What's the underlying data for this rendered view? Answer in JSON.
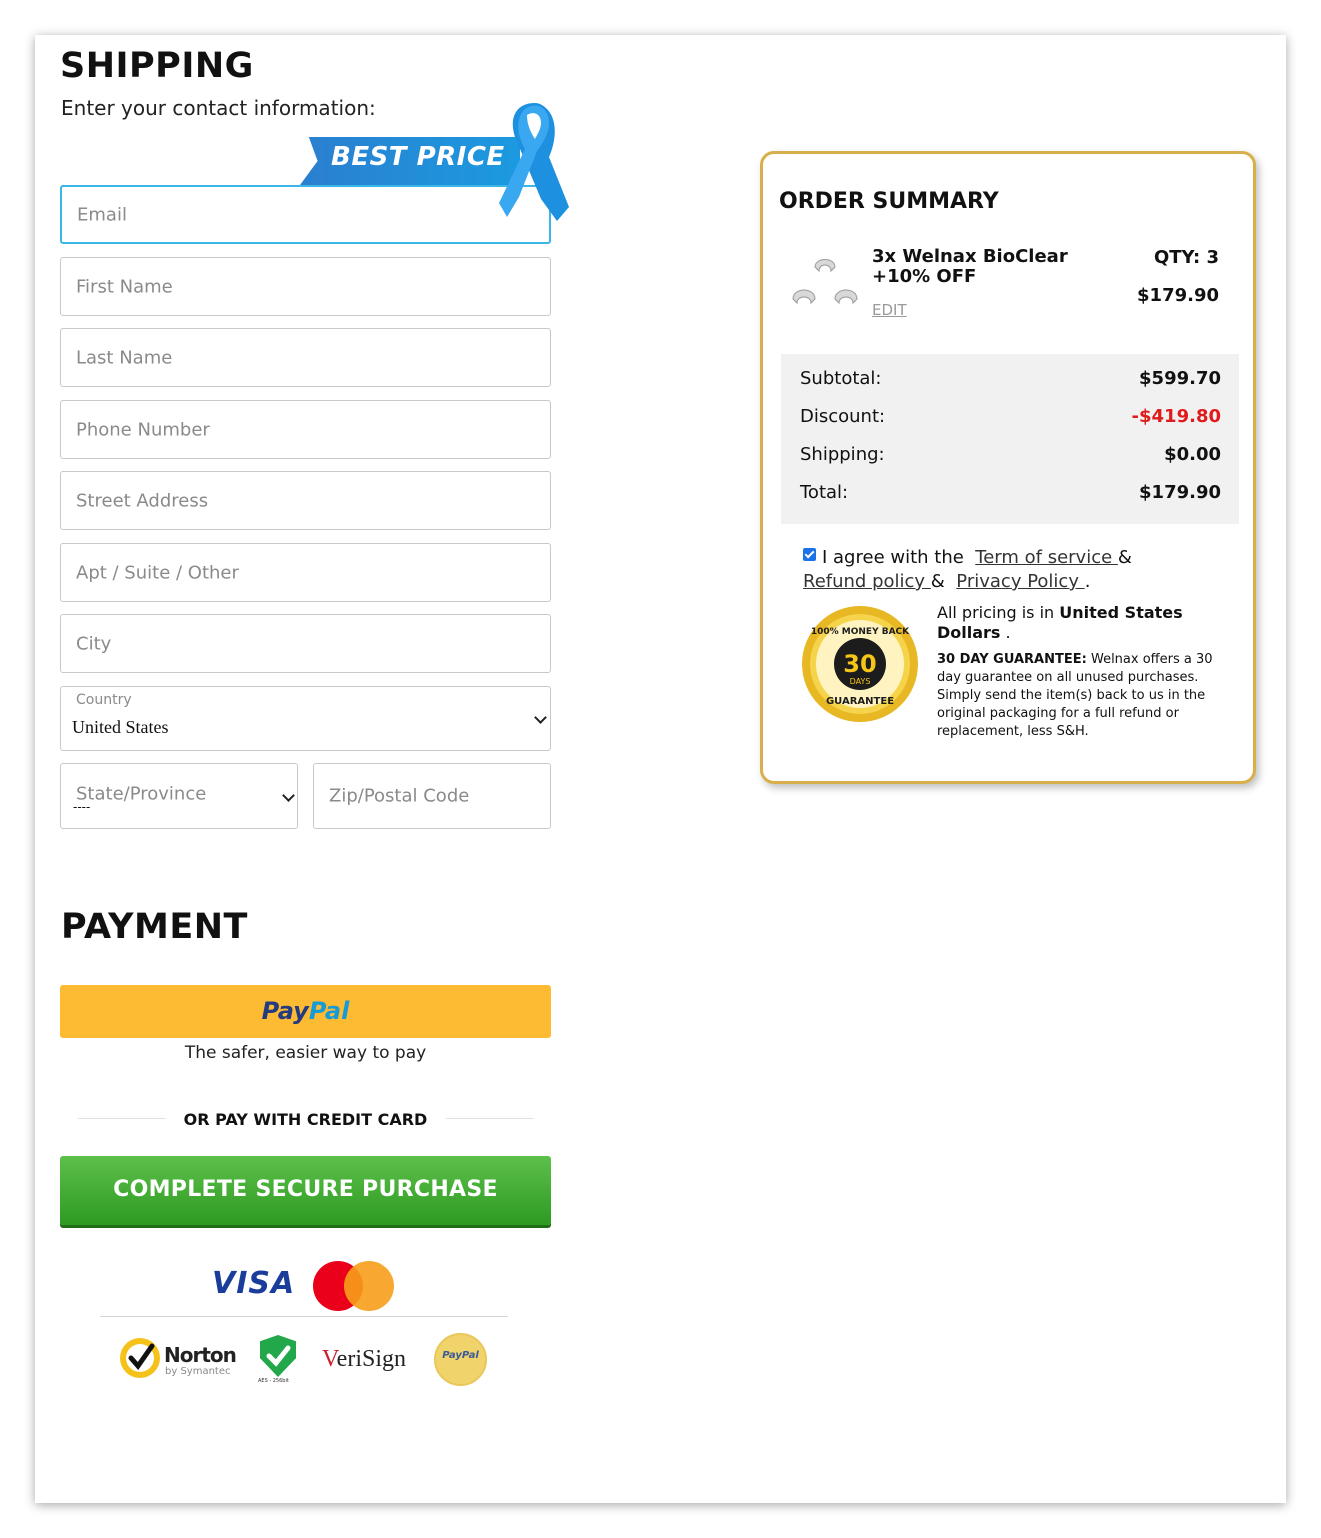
{
  "shipping": {
    "title": "SHIPPING",
    "subtitle": "Enter your contact information:",
    "badge": "BEST PRICE",
    "fields": {
      "email": "Email",
      "first_name": "First Name",
      "last_name": "Last Name",
      "phone": "Phone Number",
      "street": "Street Address",
      "apt": "Apt / Suite / Other",
      "city": "City",
      "country_label": "Country",
      "country_value": "United States",
      "state": "State/Province",
      "state_sub": "----",
      "zip": "Zip/Postal Code"
    }
  },
  "payment": {
    "title": "PAYMENT",
    "paypal_pay": "Pay",
    "paypal_pal": "Pal",
    "paypal_tagline": "The safer, easier way to pay",
    "divider": "OR PAY WITH CREDIT CARD",
    "submit_label": "COMPLETE SECURE PURCHASE",
    "card_logos": [
      "VISA",
      "mastercard-icon"
    ],
    "trust": {
      "norton": "Norton",
      "norton_sub": "by Symantec",
      "shield_sub": "AES - 256bit",
      "verisign_v": "V",
      "verisign_rest": "eriSign",
      "paypal_seal": "PayPal"
    }
  },
  "order_summary": {
    "title": "ORDER SUMMARY",
    "product": {
      "name": "3x Welnax BioClear +10% OFF",
      "edit": "EDIT",
      "qty": "QTY: 3",
      "price": "$179.90"
    },
    "totals": [
      {
        "label": "Subtotal:",
        "value": "$599.70"
      },
      {
        "label": "Discount:",
        "value": "-$419.80"
      },
      {
        "label": "Shipping:",
        "value": "$0.00"
      },
      {
        "label": "Total:",
        "value": "$179.90"
      }
    ],
    "agree": {
      "prefix": "I agree with the",
      "terms": "Term of service ",
      "amp1": "&",
      "refund": "Refund policy ",
      "amp2": "&",
      "privacy": "Privacy Policy ",
      "end": "."
    },
    "pricing_prefix": "All pricing is in",
    "pricing_currency": "United States Dollars",
    "pricing_end": " .",
    "guarantee_title": "30 DAY GUARANTEE:",
    "guarantee_text": " Welnax offers a 30 day guarantee on all unused purchases. Simply send the item(s) back to us in the original packaging for a full refund or replacement, less S&H.",
    "seal": {
      "top": "100% MONEY BACK",
      "number": "30",
      "days": "DAYS",
      "bottom": "GUARANTEE"
    }
  },
  "colors": {
    "accent_blue": "#3ab6e8",
    "paypal_yellow": "#fcbb32",
    "purchase_green": "#3aa52b",
    "summary_border": "#d7b04b",
    "discount_red": "#e01b1b"
  }
}
